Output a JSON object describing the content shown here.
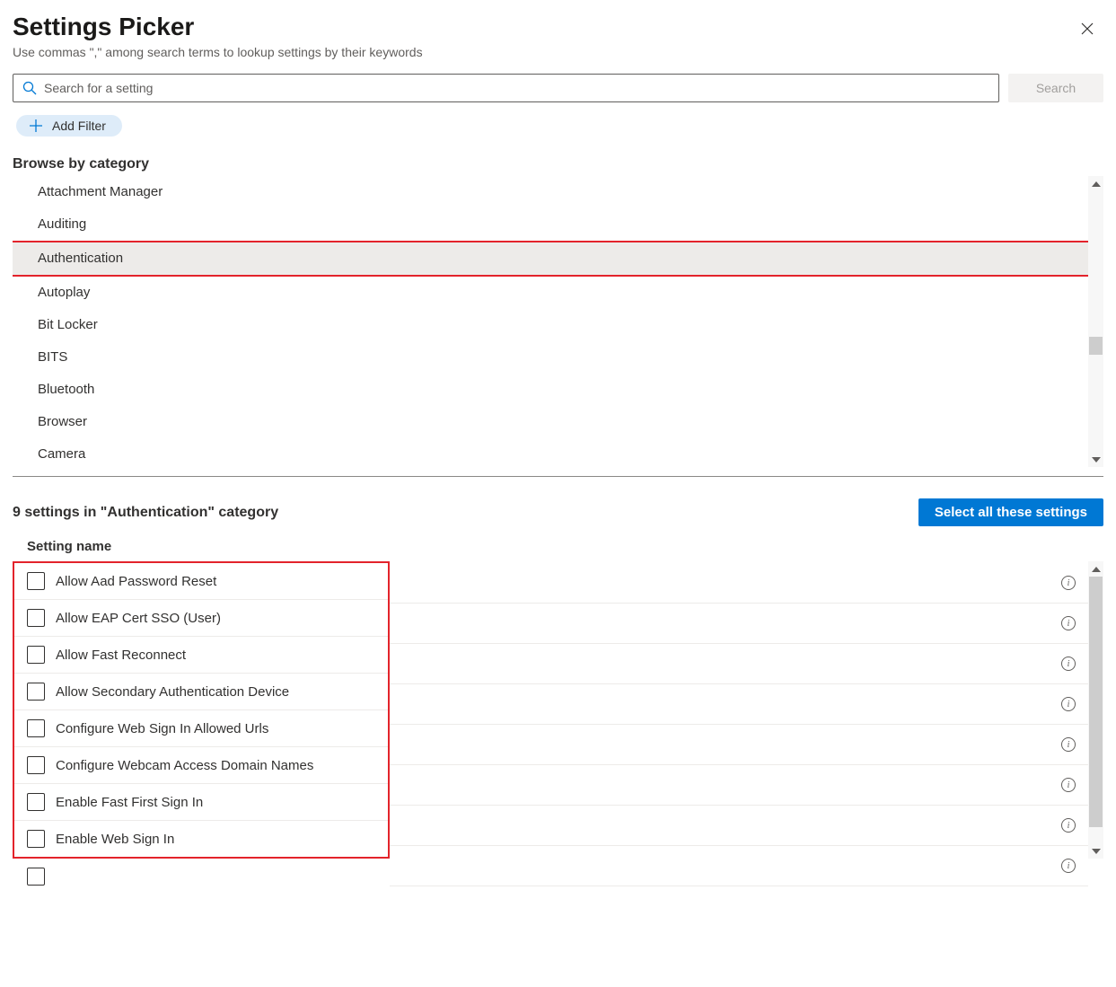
{
  "header": {
    "title": "Settings Picker",
    "subtitle": "Use commas \",\" among search terms to lookup settings by their keywords"
  },
  "search": {
    "placeholder": "Search for a setting",
    "button": "Search"
  },
  "filter": {
    "add_label": "Add Filter"
  },
  "browse": {
    "heading": "Browse by category",
    "categories": [
      {
        "label": "Attachment Manager",
        "selected": false
      },
      {
        "label": "Auditing",
        "selected": false
      },
      {
        "label": "Authentication",
        "selected": true
      },
      {
        "label": "Autoplay",
        "selected": false
      },
      {
        "label": "Bit Locker",
        "selected": false
      },
      {
        "label": "BITS",
        "selected": false
      },
      {
        "label": "Bluetooth",
        "selected": false
      },
      {
        "label": "Browser",
        "selected": false
      },
      {
        "label": "Camera",
        "selected": false
      }
    ]
  },
  "results": {
    "count_text": "9 settings in \"Authentication\" category",
    "select_all": "Select all these settings",
    "column_header": "Setting name",
    "settings": [
      {
        "name": "Allow Aad Password Reset"
      },
      {
        "name": "Allow EAP Cert SSO (User)"
      },
      {
        "name": "Allow Fast Reconnect"
      },
      {
        "name": "Allow Secondary Authentication Device"
      },
      {
        "name": "Configure Web Sign In Allowed Urls"
      },
      {
        "name": "Configure Webcam Access Domain Names"
      },
      {
        "name": "Enable Fast First Sign In"
      },
      {
        "name": "Enable Web Sign In"
      }
    ]
  },
  "highlight_color": "#e3232b",
  "accent_color": "#0078d4"
}
